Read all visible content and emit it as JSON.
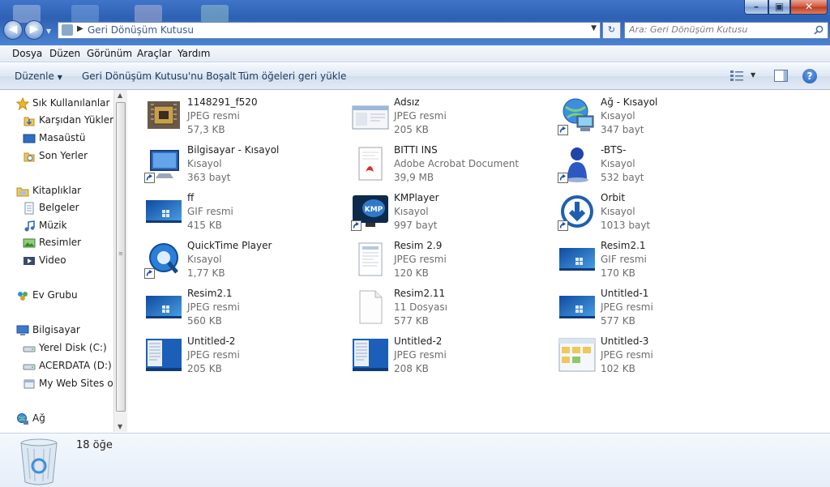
{
  "window": {
    "address_path": "Geri Dönüşüm Kutusu",
    "search_placeholder": "Ara: Geri Dönüşüm Kutusu"
  },
  "menu": [
    "Dosya",
    "Düzen",
    "Görünüm",
    "Araçlar",
    "Yardım"
  ],
  "commandbar": {
    "organize": "Düzenle",
    "empty_bin": "Geri Dönüşüm Kutusu'nu Boşalt",
    "restore_all": "Tüm öğeleri geri yükle"
  },
  "nav": [
    {
      "label": "Sık Kullanılanlar",
      "icon": "star-icon"
    },
    {
      "label": "Karşıdan Yükleme",
      "icon": "downloads-icon"
    },
    {
      "label": "Masaüstü",
      "icon": "desktop-icon"
    },
    {
      "label": "Son Yerler",
      "icon": "recent-places-icon"
    },
    {
      "label": "Kitaplıklar",
      "icon": "libraries-icon"
    },
    {
      "label": "Belgeler",
      "icon": "documents-icon"
    },
    {
      "label": "Müzik",
      "icon": "music-icon"
    },
    {
      "label": "Resimler",
      "icon": "pictures-icon"
    },
    {
      "label": "Video",
      "icon": "video-icon"
    },
    {
      "label": "Ev Grubu",
      "icon": "homegroup-icon"
    },
    {
      "label": "Bilgisayar",
      "icon": "computer-icon"
    },
    {
      "label": "Yerel Disk (C:)",
      "icon": "drive-icon"
    },
    {
      "label": "ACERDATA (D:)",
      "icon": "drive-icon"
    },
    {
      "label": "My Web Sites on",
      "icon": "web-sites-icon"
    },
    {
      "label": "Ağ",
      "icon": "network-icon"
    }
  ],
  "files": [
    {
      "name": "1148291_f520",
      "type": "JPEG resmi",
      "size": "57,3 KB",
      "icon": "chip-photo-icon"
    },
    {
      "name": "Adsız",
      "type": "JPEG resmi",
      "size": "205 KB",
      "icon": "window-screenshot-icon"
    },
    {
      "name": "Ağ - Kısayol",
      "type": "Kısayol",
      "size": "347 bayt",
      "icon": "network-shortcut-icon"
    },
    {
      "name": "Bilgisayar - Kısayol",
      "type": "Kısayol",
      "size": "363 bayt",
      "icon": "computer-shortcut-icon"
    },
    {
      "name": "BITTI INS",
      "type": "Adobe Acrobat Document",
      "size": "39,9 MB",
      "icon": "pdf-icon"
    },
    {
      "name": "-BTS-",
      "type": "Kısayol",
      "size": "532 bayt",
      "icon": "user-shortcut-icon"
    },
    {
      "name": "ff",
      "type": "GIF resmi",
      "size": "415 KB",
      "icon": "desktop-wallpaper-icon"
    },
    {
      "name": "KMPlayer",
      "type": "Kısayol",
      "size": "997 bayt",
      "icon": "kmplayer-icon"
    },
    {
      "name": "Orbit",
      "type": "Kısayol",
      "size": "1013 bayt",
      "icon": "orbit-download-icon"
    },
    {
      "name": "QuickTime Player",
      "type": "Kısayol",
      "size": "1,77 KB",
      "icon": "quicktime-icon"
    },
    {
      "name": "Resim 2.9",
      "type": "JPEG resmi",
      "size": "120 KB",
      "icon": "document-image-icon"
    },
    {
      "name": "Resim2.1",
      "type": "GIF resmi",
      "size": "170 KB",
      "icon": "desktop-wallpaper-icon"
    },
    {
      "name": "Resim2.1",
      "type": "JPEG resmi",
      "size": "560 KB",
      "icon": "desktop-wallpaper-icon"
    },
    {
      "name": "Resim2.11",
      "type": "11 Dosyası",
      "size": "577 KB",
      "icon": "blank-file-icon"
    },
    {
      "name": "Untitled-1",
      "type": "JPEG resmi",
      "size": "577 KB",
      "icon": "desktop-wallpaper-icon"
    },
    {
      "name": "Untitled-2",
      "type": "JPEG resmi",
      "size": "205 KB",
      "icon": "start-menu-screenshot-icon"
    },
    {
      "name": "Untitled-2",
      "type": "JPEG resmi",
      "size": "208 KB",
      "icon": "start-menu-screenshot-icon"
    },
    {
      "name": "Untitled-3",
      "type": "JPEG resmi",
      "size": "102 KB",
      "icon": "folder-screenshot-icon"
    }
  ],
  "details": {
    "count": "18 öğe"
  }
}
